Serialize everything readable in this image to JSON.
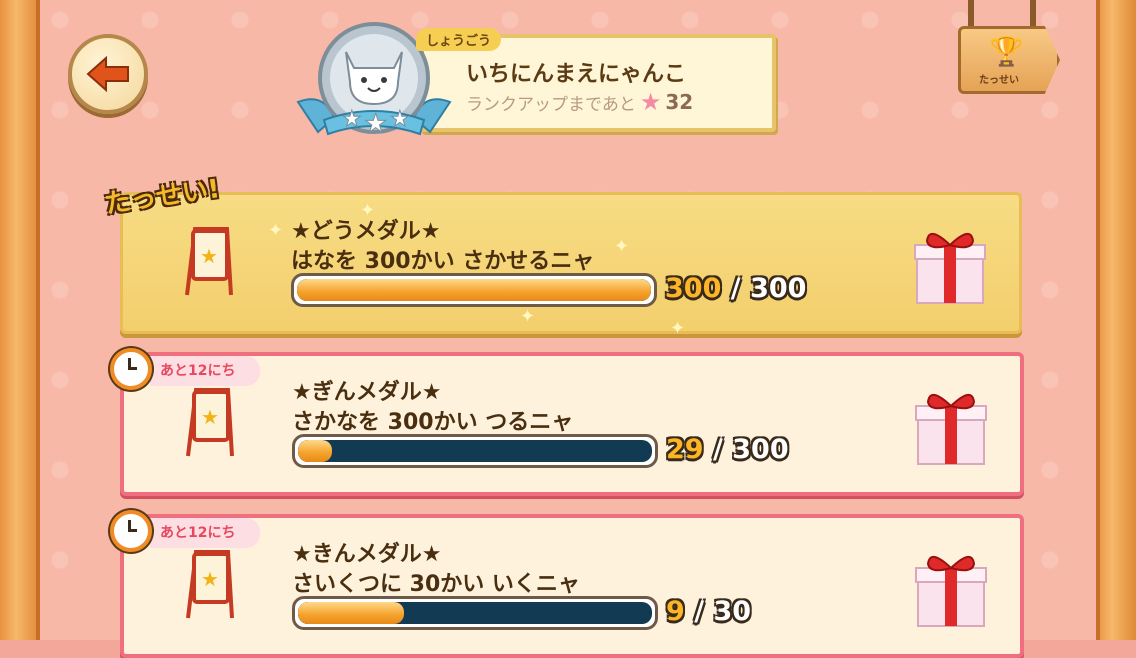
{
  "title_plate": {
    "tag": "しょうごう",
    "name": "いちにんまえにゃんこ",
    "rank_up_text": "ランクアップまであと",
    "rank_up_count": "32"
  },
  "achievements_sign": {
    "label": "たっせい"
  },
  "achievements": [
    {
      "status_label": "たっせい!",
      "medal_name": "★どうメダル★",
      "task": "はなを 300かい さかせるニャ",
      "current": "300",
      "separator": "/",
      "target": "300",
      "progress": 1.0
    },
    {
      "time_left": "あと12にち",
      "medal_name": "★ぎんメダル★",
      "task": "さかなを 300かい つるニャ",
      "current": "29",
      "separator": "/",
      "target": "300",
      "progress": 0.097
    },
    {
      "time_left": "あと12にち",
      "medal_name": "★きんメダル★",
      "task": "さいくつに 30かい いくニャ",
      "current": "9",
      "separator": "/",
      "target": "30",
      "progress": 0.3
    }
  ],
  "colors": {
    "background": "#f7b8a8",
    "frame": "#e8913e",
    "done_row": "#f3cf6d",
    "pending_border": "#ef6f7f",
    "bar_fill": "#f5a12b",
    "bar_track": "#123a52"
  }
}
